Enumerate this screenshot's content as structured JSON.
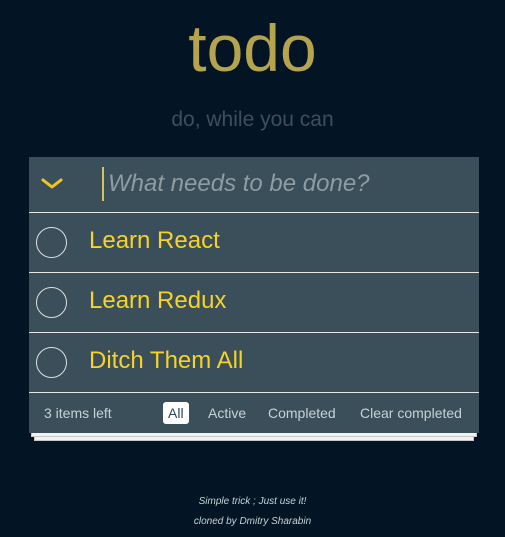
{
  "header": {
    "title": "todo",
    "subtitle": "do, while you can"
  },
  "new_todo": {
    "placeholder": "What needs to be done?",
    "value": ""
  },
  "todos": [
    {
      "label": "Learn React",
      "completed": false
    },
    {
      "label": "Learn Redux",
      "completed": false
    },
    {
      "label": "Ditch Them All",
      "completed": false
    }
  ],
  "footer": {
    "items_left": "3 items left",
    "filters": [
      {
        "label": "All",
        "selected": true
      },
      {
        "label": "Active",
        "selected": false
      },
      {
        "label": "Completed",
        "selected": false
      }
    ],
    "clear_completed": "Clear completed"
  },
  "info": {
    "line1": "Simple trick ; Just use it!",
    "line2": "cloned by Dmitry Sharabin"
  },
  "colors": {
    "background": "#031525",
    "title": "#b5a44d",
    "panel": "#3a4f59",
    "todo_text": "#f5d327",
    "toggle_arrow": "#f5c518"
  },
  "icons": {
    "toggle_all": "chevron-down-icon",
    "todo_checkbox": "circle-checkbox-icon"
  }
}
